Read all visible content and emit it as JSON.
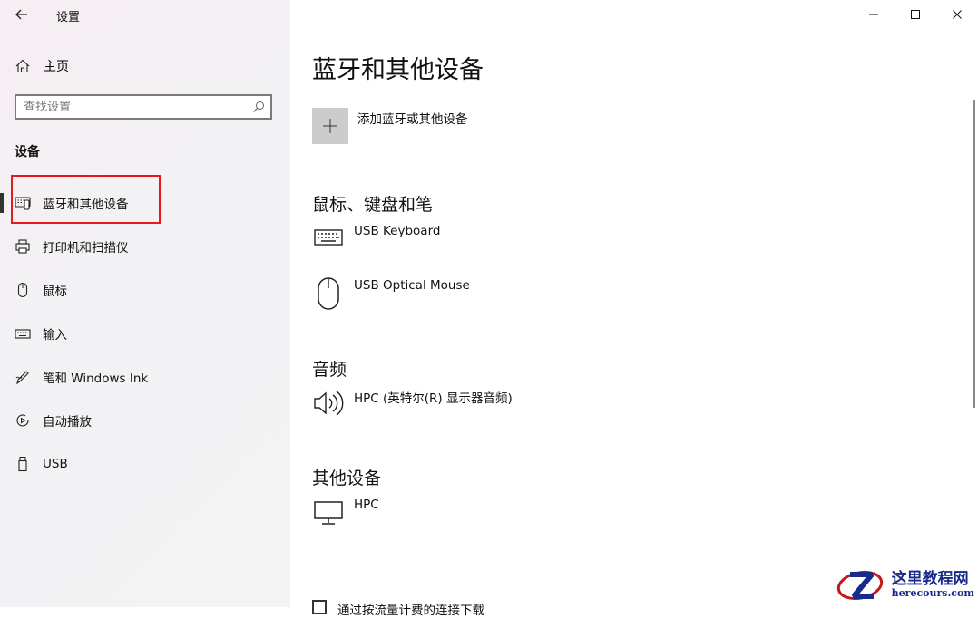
{
  "window": {
    "title": "设置",
    "controls": [
      "minimize-icon",
      "maximize-icon",
      "close-icon"
    ]
  },
  "sidebar": {
    "home_label": "主页",
    "search_placeholder": "查找设置",
    "section_title": "设备",
    "items": [
      {
        "label": "蓝牙和其他设备",
        "icon": "bluetooth-devices-icon",
        "active": true
      },
      {
        "label": "打印机和扫描仪",
        "icon": "printer-icon"
      },
      {
        "label": "鼠标",
        "icon": "mouse-icon"
      },
      {
        "label": "输入",
        "icon": "keyboard-icon"
      },
      {
        "label": "笔和 Windows Ink",
        "icon": "pen-icon"
      },
      {
        "label": "自动播放",
        "icon": "autoplay-icon"
      },
      {
        "label": "USB",
        "icon": "usb-icon"
      }
    ]
  },
  "main": {
    "title": "蓝牙和其他设备",
    "add_device_label": "添加蓝牙或其他设备",
    "groups": [
      {
        "title": "鼠标、键盘和笔",
        "devices": [
          {
            "name": "USB Keyboard",
            "icon": "keyboard-icon"
          },
          {
            "name": "USB Optical Mouse",
            "icon": "mouse-icon"
          }
        ]
      },
      {
        "title": "音频",
        "devices": [
          {
            "name": "HPC (英特尔(R) 显示器音频)",
            "icon": "speaker-icon"
          }
        ]
      },
      {
        "title": "其他设备",
        "devices": [
          {
            "name": "HPC",
            "icon": "monitor-icon"
          }
        ]
      }
    ],
    "bottom_checkbox_label": "通过按流量计费的连接下载"
  },
  "watermark": {
    "main": "这里教程网",
    "sub": "herecours.com"
  },
  "colors": {
    "highlight": "#e51a1a",
    "watermark": "#1a2a8a"
  }
}
